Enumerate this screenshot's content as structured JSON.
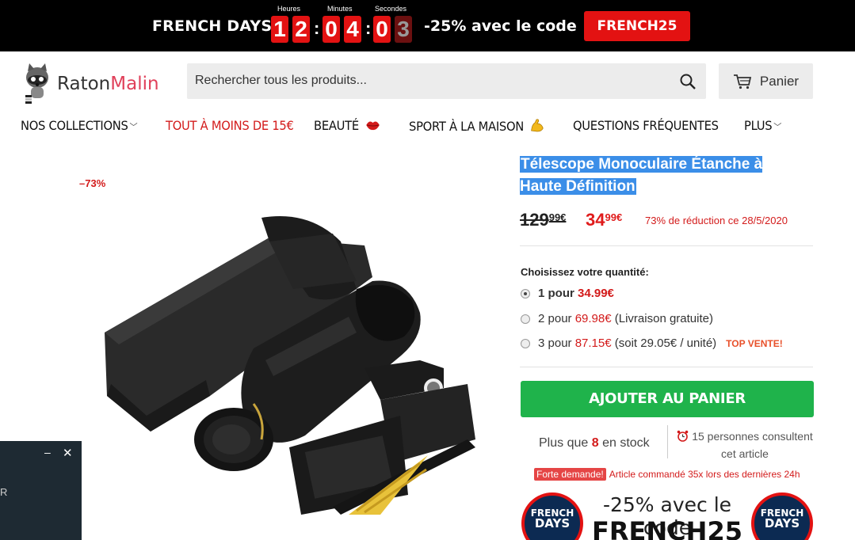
{
  "topbar": {
    "title": "FRENCH DAYS",
    "labels": {
      "hours": "Heures",
      "minutes": "Minutes",
      "seconds": "Secondes"
    },
    "digits": [
      "1",
      "2",
      "0",
      "4",
      "0",
      "3"
    ],
    "promo": "-25% avec le code",
    "code": "FRENCH25"
  },
  "header": {
    "logo_a": "Raton",
    "logo_b": "Malin",
    "search_placeholder": "Rechercher tous les produits...",
    "cart_label": "Panier"
  },
  "nav": {
    "collections": "NOS COLLECTIONS",
    "under15": "TOUT À MOINS DE 15€",
    "beauty": "BEAUTÉ",
    "sport": "SPORT À LA MAISON",
    "faq": "QUESTIONS FRÉQUENTES",
    "more": "PLUS"
  },
  "product": {
    "discount_tag": "–73%",
    "title": "Télescope Monoculaire Étanche à Haute Définition",
    "old_price_int": "129",
    "old_price_dec": "99€",
    "new_price_int": "34",
    "new_price_dec": "99€",
    "price_note": "73% de réduction ce 28/5/2020",
    "qty_label": "Choisissez votre quantité:",
    "options": [
      {
        "prefix": "1 pour ",
        "price": "34.99€",
        "suffix": ""
      },
      {
        "prefix": "2 pour ",
        "price": "69.98€",
        "suffix": " (Livraison gratuite)"
      },
      {
        "prefix": "3 pour ",
        "price": "87.15€",
        "suffix": " (soit 29.05€ / unité)",
        "badge": "TOP VENTE!"
      }
    ],
    "add_to_cart": "AJOUTER AU PANIER",
    "stock_a": "Plus que ",
    "stock_n": "8",
    "stock_b": " en stock",
    "viewers": "15 personnes consultent cet article",
    "forte_badge": "Forte demande!",
    "forte_text": "Article commandé 35x lors des dernières 24h",
    "banner_text": "-25% avec le code",
    "banner_code": "FRENCH25",
    "banner_badge_l1": "FRENCH",
    "banner_badge_l2": "DAYS"
  },
  "chat": {
    "min": "–",
    "close": "✕",
    "text": "R"
  },
  "colors": {
    "accent_red": "#e31212",
    "green": "#1fb34b",
    "selection": "#3b8ee8"
  }
}
